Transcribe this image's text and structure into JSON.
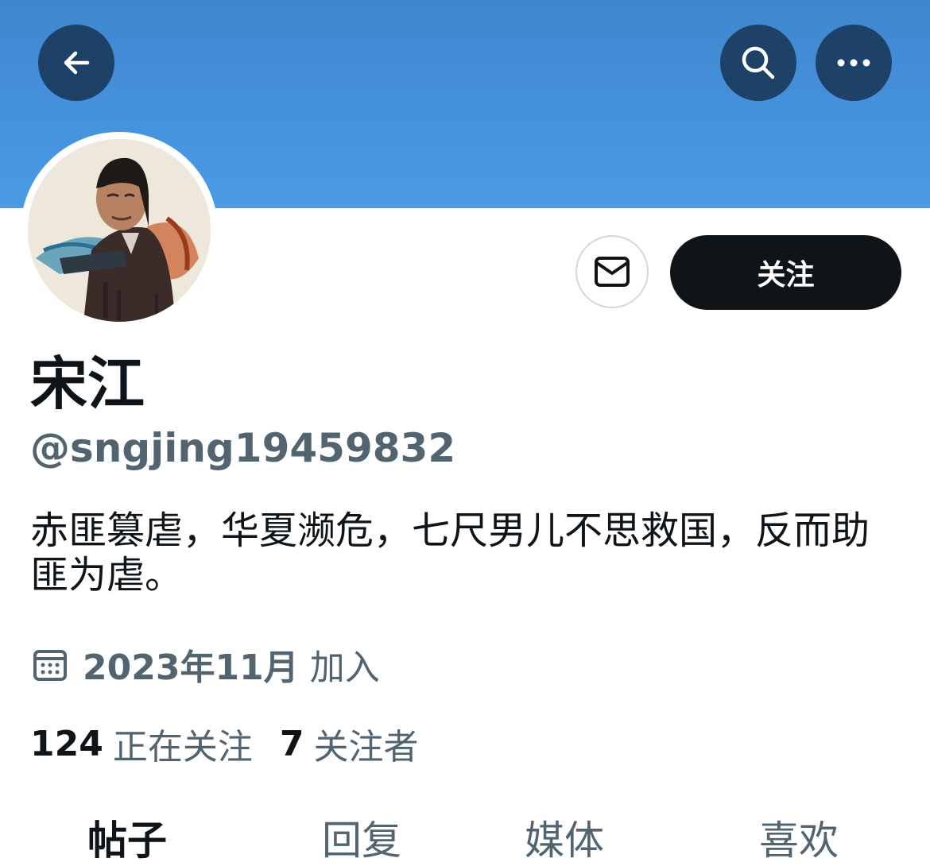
{
  "header": {
    "back_icon": "arrow-left-icon",
    "search_icon": "search-icon",
    "more_icon": "more-horizontal-icon",
    "banner_color": "#4a9ae6"
  },
  "profile": {
    "display_name": "宋江",
    "handle": "@sngjing19459832",
    "bio": "赤匪篡虐，华夏濒危，七尺男儿不思救国，反而助匪为虐。",
    "joined_date": "2023年11月",
    "joined_suffix": "加入",
    "following_count": "124",
    "following_label": "正在关注",
    "followers_count": "7",
    "followers_label": "关注者"
  },
  "actions": {
    "message_icon": "envelope-icon",
    "follow_label": "关注"
  },
  "tabs": [
    {
      "label": "帖子",
      "active": true
    },
    {
      "label": "回复",
      "active": false
    },
    {
      "label": "媒体",
      "active": false
    },
    {
      "label": "喜欢",
      "active": false
    }
  ]
}
